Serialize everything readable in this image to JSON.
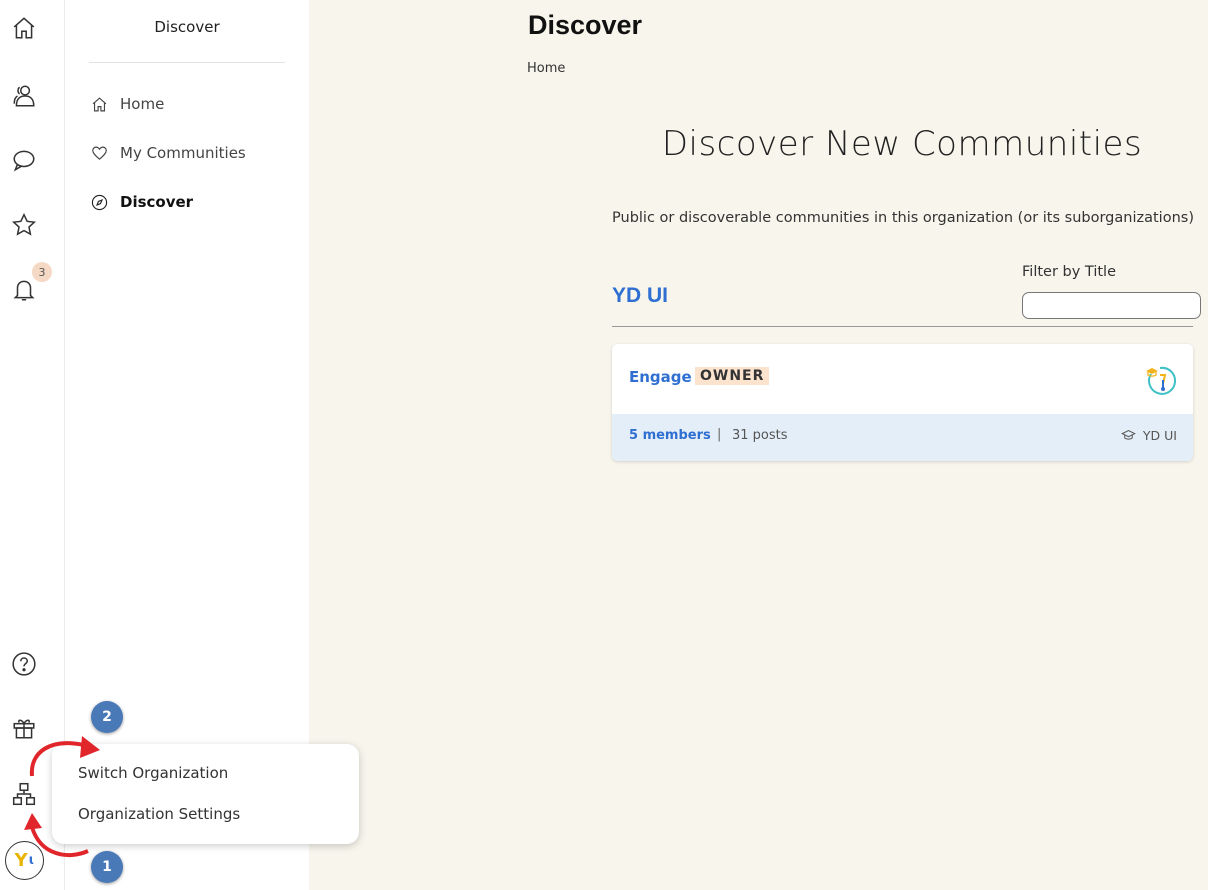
{
  "rail": {
    "notification_count": "3",
    "avatar_letter": "Y"
  },
  "sidebar": {
    "title": "Discover",
    "items": [
      {
        "label": "Home",
        "icon": "home-icon"
      },
      {
        "label": "My Communities",
        "icon": "heart-icon"
      },
      {
        "label": "Discover",
        "icon": "compass-icon",
        "active": true
      }
    ]
  },
  "main": {
    "title": "Discover",
    "breadcrumb": "Home",
    "hero": "Discover New Communities",
    "subtitle": "Public or discoverable communities in this organization (or its suborganizations)",
    "org_name": "YD UI",
    "filter": {
      "label": "Filter by Title",
      "value": "",
      "placeholder": ""
    },
    "communities": [
      {
        "name": "Engage",
        "role": "OWNER",
        "members": "5 members",
        "separator": "|",
        "posts": "31 posts",
        "org": "YD UI"
      }
    ]
  },
  "popup": {
    "items": [
      "Switch Organization",
      "Organization Settings"
    ]
  },
  "annotations": {
    "step1": "1",
    "step2": "2"
  },
  "colors": {
    "accent": "#2e6fd1",
    "background": "#f7f5ec",
    "role_badge_bg": "#fbe3cd",
    "card_footer_bg": "#e4eef8",
    "annotation_arrow": "#e0262b",
    "step_circle": "#4a79b8"
  }
}
